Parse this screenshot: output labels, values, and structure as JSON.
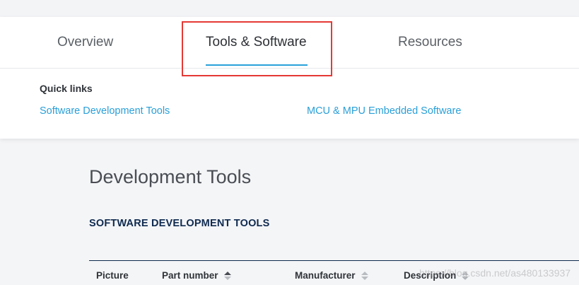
{
  "tabs": [
    {
      "label": "Overview"
    },
    {
      "label": "Tools & Software"
    },
    {
      "label": "Resources"
    }
  ],
  "quick_links": {
    "title": "Quick links",
    "items": [
      {
        "label": "Software Development Tools"
      },
      {
        "label": "MCU & MPU Embedded Software"
      }
    ]
  },
  "main": {
    "page_title": "Development Tools",
    "section_title": "SOFTWARE DEVELOPMENT TOOLS",
    "table_headers": [
      {
        "label": "Picture"
      },
      {
        "label": "Part number"
      },
      {
        "label": "Manufacturer"
      },
      {
        "label": "Description"
      }
    ]
  },
  "watermark": "https://blog.csdn.net/as480133937",
  "colors": {
    "accent": "#2aa1d9",
    "link": "#2a9fd8",
    "highlight": "#e53935",
    "section_title": "#0f2a4f"
  }
}
